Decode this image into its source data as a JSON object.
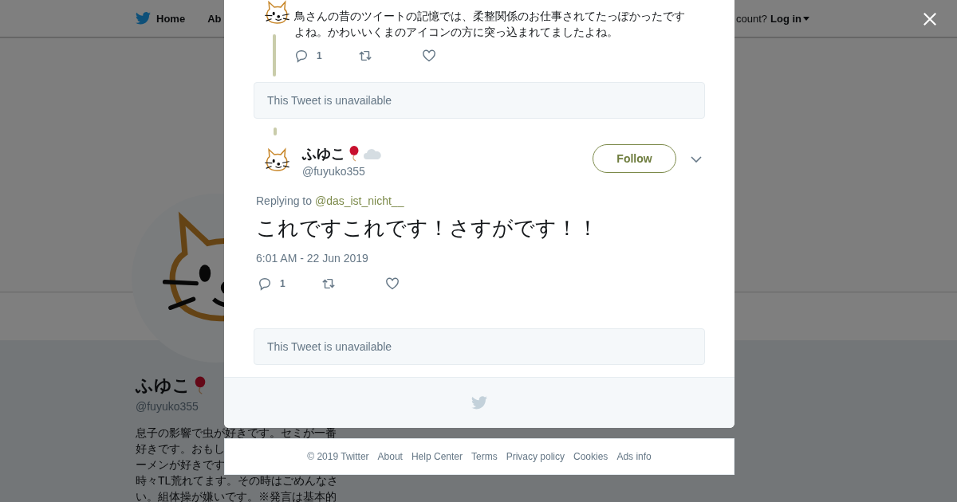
{
  "nav": {
    "items": [
      {
        "label": "Home",
        "kind": "home"
      },
      {
        "label": "Ab",
        "kind": "text"
      }
    ],
    "account_prompt": "count?",
    "login": "Log in"
  },
  "profile": {
    "name": "ふゆこ",
    "handle": "@fuyuko355",
    "bio_lines": [
      "息子の影響で虫が好きです。セミが一番",
      "好きです。おもし",
      "ーメンが好きです",
      "時々TL荒れてます。その時はごめんなさ",
      "い。組体操が嫌いです。※発言は基本的"
    ]
  },
  "modal": {
    "items": [
      {
        "kind": "tweet",
        "text": "鳥さんの昔のツイートの記憶では、柔整関係のお仕事されてたっぽかったですよね。かわいいくまのアイコンの方に突っ込まれてましたよね。",
        "replies": "1"
      },
      {
        "kind": "unavailable",
        "text": "This Tweet is unavailable"
      },
      {
        "kind": "focused",
        "name": "ふゆこ",
        "handle": "@fuyuko355",
        "follow": "Follow",
        "replying_label": "Replying to",
        "replying_to": "@das_ist_nicht__",
        "text": "これですこれです！さすがです！！",
        "time": "6:01 AM - 22 Jun 2019",
        "replies": "1"
      },
      {
        "kind": "unavailable",
        "text": "This Tweet is unavailable"
      }
    ]
  },
  "footer": {
    "copyright": "© 2019 Twitter",
    "links": [
      "About",
      "Help Center",
      "Terms",
      "Privacy policy",
      "Cookies",
      "Ads info"
    ]
  }
}
